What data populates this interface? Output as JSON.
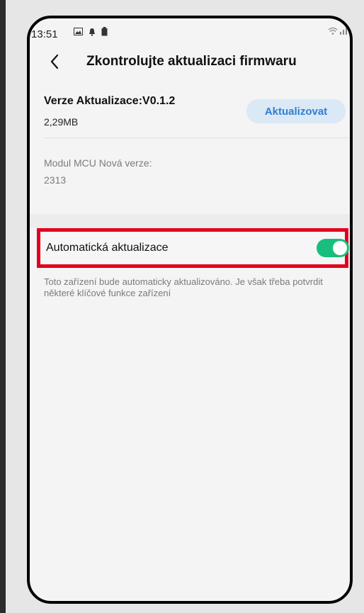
{
  "status": {
    "time": "13:51",
    "icons": [
      "image-icon",
      "bell-icon",
      "battery-saver-icon",
      "wifi-icon",
      "signal-icon"
    ]
  },
  "header": {
    "title": "Zkontrolujte aktualizaci firmwaru"
  },
  "update": {
    "version": "Verze Aktualizace:V0.1.2",
    "size": "2,29MB",
    "button_label": "Aktualizovat"
  },
  "mcu": {
    "label": "Modul MCU Nová verze:",
    "value": "2313"
  },
  "auto_update": {
    "label": "Automatická aktualizace",
    "enabled": true,
    "description": "Toto zařízení bude automaticky aktualizováno. Je však třeba potvrdit některé klíčové funkce zařízení"
  },
  "colors": {
    "toggle_on": "#18bf7c",
    "accent": "#2e7fd0",
    "highlight": "#e3001b"
  }
}
